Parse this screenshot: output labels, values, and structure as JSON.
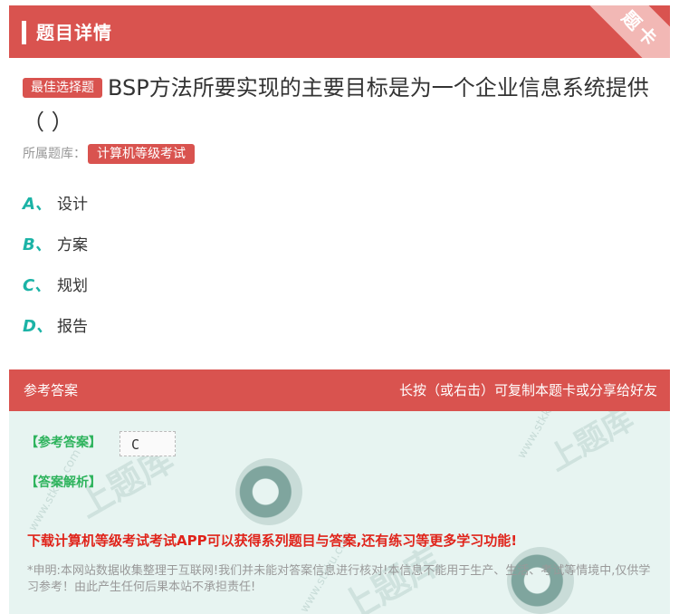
{
  "header": {
    "title": "题目详情",
    "corner_label": "题卡"
  },
  "question": {
    "tag": "最佳选择题",
    "text": "BSP方法所要实现的主要目标是为一个企业信息系统提供（ ）"
  },
  "bank": {
    "label": "所属题库：",
    "name": "计算机等级考试"
  },
  "options": [
    {
      "letter": "A、",
      "text": "设计"
    },
    {
      "letter": "B、",
      "text": "方案"
    },
    {
      "letter": "C、",
      "text": "规划"
    },
    {
      "letter": "D、",
      "text": "报告"
    }
  ],
  "answer_section": {
    "title": "参考答案",
    "hint": "长按（或右击）可复制本题卡或分享给好友",
    "ref_label": "【参考答案】",
    "ref_value": "C",
    "analysis_label": "【答案解析】",
    "promo": "下载计算机等级考试考试APP可以获得系列题目与答案,还有练习等更多学习功能!",
    "disclaimer": "*申明:本网站数据收集整理于互联网!我们并未能对答案信息进行核对!本信息不能用于生产、生活、考试等情境中,仅供学习参考！由此产生任何后果本站不承担责任!"
  },
  "watermark": {
    "domain": "www.stkku.com",
    "brand": "上题库"
  },
  "colors": {
    "primary": "#d9534f",
    "option_letter": "#1bb3a6",
    "answer_bg": "#e7f4f1",
    "answer_label": "#2db35c",
    "promo": "#e0241b"
  }
}
